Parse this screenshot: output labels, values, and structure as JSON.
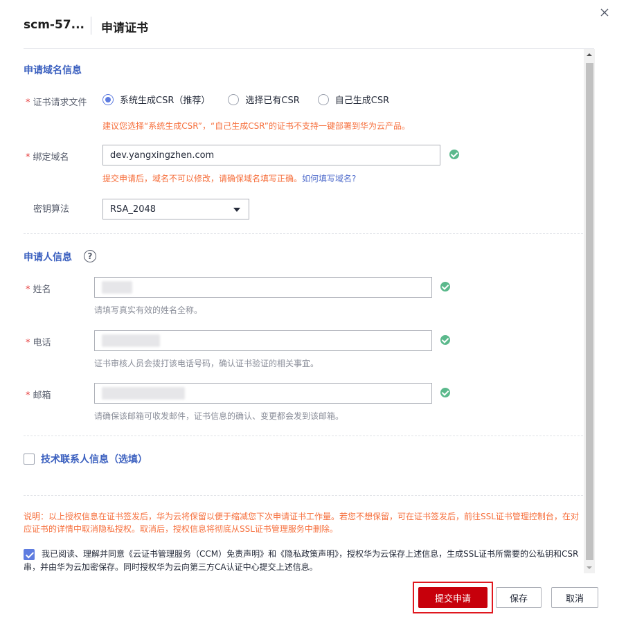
{
  "header": {
    "app_name": "scm-57...",
    "title": "申请证书"
  },
  "domain_section": {
    "title": "申请域名信息",
    "csr_label": "证书请求文件",
    "csr_options": [
      {
        "label": "系统生成CSR（推荐）",
        "checked": true
      },
      {
        "label": "选择已有CSR",
        "checked": false
      },
      {
        "label": "自己生成CSR",
        "checked": false
      }
    ],
    "csr_hint": "建议您选择“系统生成CSR”，“自己生成CSR”的证书不支持一键部署到华为云产品。",
    "domain_label": "绑定域名",
    "domain_value": "dev.yangxingzhen.com",
    "domain_hint": "提交申请后，域名不可以修改，请确保域名填写正确。",
    "domain_hint_link": "如何填写域名?",
    "algo_label": "密钥算法",
    "algo_value": "RSA_2048"
  },
  "applicant_section": {
    "title": "申请人信息",
    "help_icon": "?",
    "name_label": "姓名",
    "name_hint": "请填写真实有效的姓名全称。",
    "phone_label": "电话",
    "phone_hint": "证书审核人员会拨打该电话号码，确认证书验证的相关事宜。",
    "email_label": "邮箱",
    "email_hint": "请确保该邮箱可收发邮件，证书信息的确认、变更都会发到该邮箱。"
  },
  "tech_contact": {
    "label": "技术联系人信息（选填）",
    "checked": false
  },
  "notice": "说明：以上授权信息在证书签发后，华为云将保留以便于缩减您下次申请证书工作量。若您不想保留，可在证书签发后，前往SSL证书管理控制台，在对应证书的详情中取消隐私授权。取消后，授权信息将彻底从SSL证书管理服务中删除。",
  "agreement": {
    "checked": true,
    "text": "我已阅读、理解并同意《云证书管理服务（CCM）免责声明》和《隐私政策声明》，授权华为云保存上述信息，生成SSL证书所需要的公私钥和CSR串，并由华为云加密保存。同时授权华为云向第三方CA认证中心提交上述信息。"
  },
  "footer": {
    "submit_label": "提交申请",
    "save_label": "保存",
    "cancel_label": "取消"
  },
  "colors": {
    "primary": "#5e7ce0",
    "submit": "#c7000b",
    "warning": "#f66f3c",
    "success": "#5bb98c",
    "section_title": "#3a5fbf"
  }
}
